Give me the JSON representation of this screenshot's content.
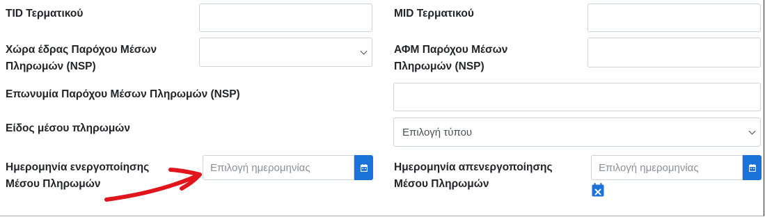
{
  "fields": {
    "tid_label": "TID Τερματικού",
    "mid_label": "MID Τερματικού",
    "nsp_country_label_line1": "Χώρα έδρας Παρόχου Μέσων",
    "nsp_country_label_line2": "Πληρωμών (NSP)",
    "nsp_afm_label_line1": "ΑΦΜ Παρόχου Μέσων",
    "nsp_afm_label_line2": "Πληρωμών (NSP)",
    "nsp_name_label": "Επωνυμία Παρόχου Μέσων Πληρωμών (NSP)",
    "payment_type_label": "Είδος μέσου πληρωμών",
    "payment_type_selected": "Επιλογή τύπου",
    "activation_label_line1": "Ημερομηνία ενεργοποίησης",
    "activation_label_line2": "Μέσου Πληρωμών",
    "deactivation_label_line1": "Ημερομηνία απενεργοποίησης",
    "deactivation_label_line2": "Μέσου Πληρωμών",
    "date_placeholder": "Επιλογή ημερομηνίας"
  },
  "icons": {
    "calendar": "calendar-icon",
    "calendar_clear": "calendar-clear-icon",
    "annotation": "red-arrow-annotation"
  },
  "colors": {
    "accent": "#1a73d9",
    "annotation": "#e0161c"
  }
}
